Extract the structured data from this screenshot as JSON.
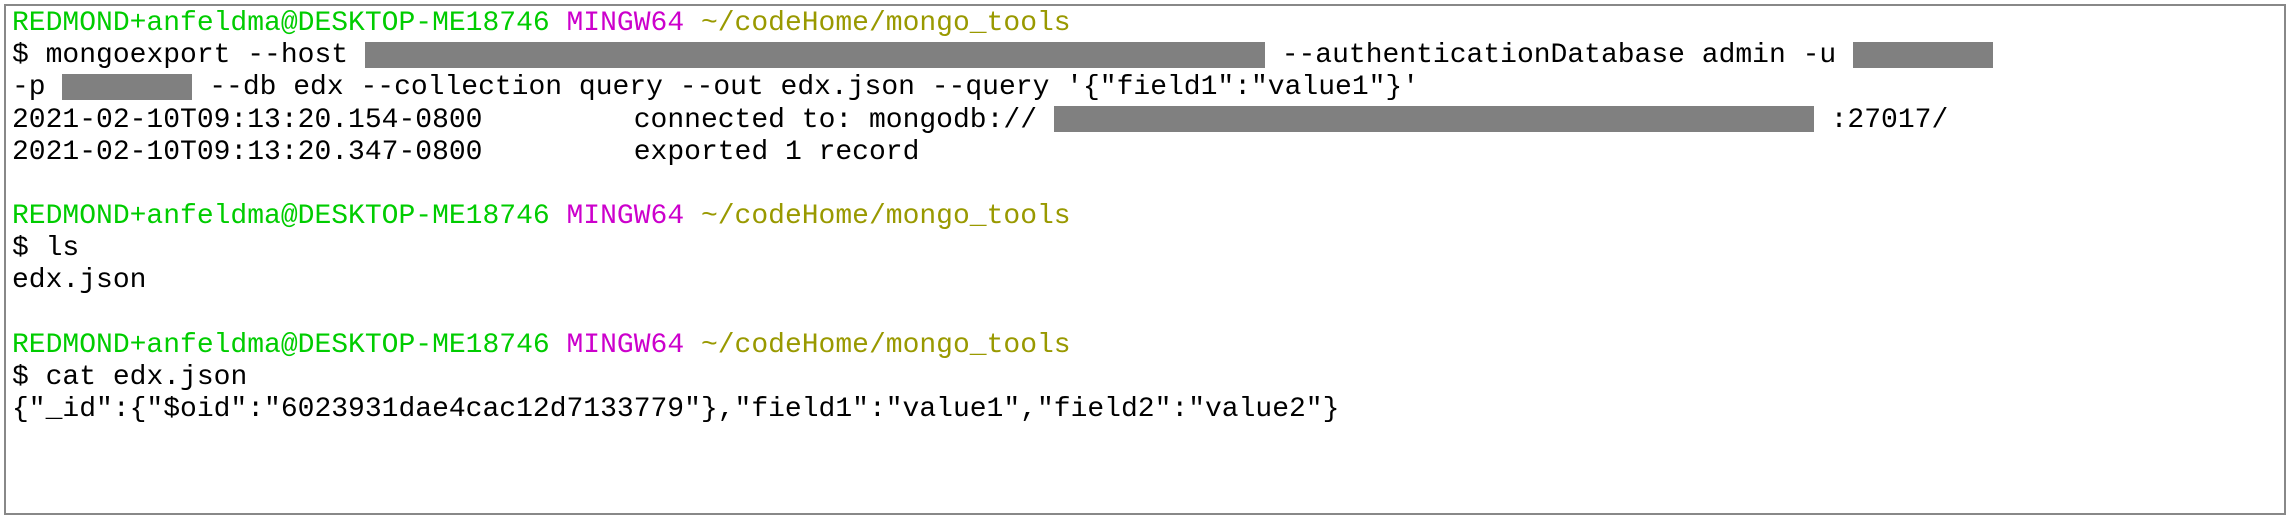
{
  "prompt": {
    "user": "REDMOND+anfeldma@DESKTOP-ME18746",
    "env": "MINGW64",
    "path": "~/codeHome/mongo_tools",
    "symbol": "$"
  },
  "block1": {
    "cmd_part1": "mongoexport --host ",
    "cmd_part2": " --authenticationDatabase admin -u ",
    "cmd_part3": "-p ",
    "cmd_part4": " --db edx --collection query --out edx.json --query '{\"field1\":\"value1\"}'",
    "out_line1_a": "2021-02-10T09:13:20.154-0800",
    "out_line1_b": "connected to: mongodb://",
    "out_line1_c": ":27017/",
    "out_line2_a": "2021-02-10T09:13:20.347-0800",
    "out_line2_b": "exported 1 record"
  },
  "block2": {
    "cmd": "ls",
    "out": "edx.json"
  },
  "block3": {
    "cmd": "cat edx.json",
    "out": "{\"_id\":{\"$oid\":\"6023931dae4cac12d7133779\"},\"field1\":\"value1\",\"field2\":\"value2\"}"
  }
}
